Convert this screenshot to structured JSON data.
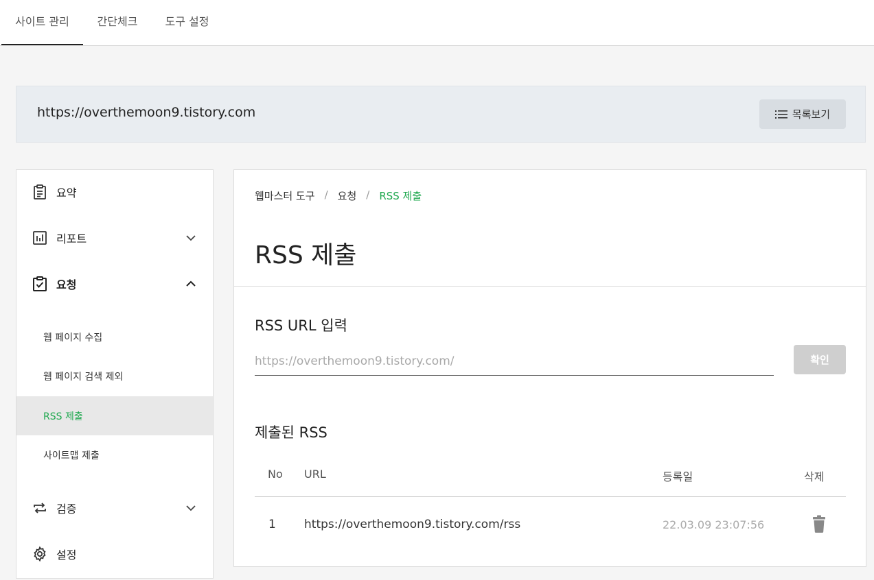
{
  "top_tabs": [
    {
      "label": "사이트 관리",
      "active": true
    },
    {
      "label": "간단체크",
      "active": false
    },
    {
      "label": "도구 설정",
      "active": false
    }
  ],
  "site": {
    "url": "https://overthemoon9.tistory.com",
    "list_button_label": "목록보기"
  },
  "sidebar": {
    "items": [
      {
        "label": "요약",
        "icon": "clipboard-icon"
      },
      {
        "label": "리포트",
        "icon": "chart-icon",
        "expanded": false
      },
      {
        "label": "요청",
        "icon": "checkbox-icon",
        "expanded": true
      },
      {
        "label": "검증",
        "icon": "repeat-icon",
        "expanded": false
      },
      {
        "label": "설정",
        "icon": "gear-icon"
      }
    ],
    "sub_items": [
      {
        "label": "웹 페이지 수집"
      },
      {
        "label": "웹 페이지 검색 제외"
      },
      {
        "label": "RSS 제출",
        "active": true
      },
      {
        "label": "사이트맵 제출"
      }
    ]
  },
  "main": {
    "breadcrumb": [
      "웹마스터 도구",
      "요청",
      "RSS 제출"
    ],
    "breadcrumb_sep": "/",
    "title": "RSS 제출",
    "rss_input": {
      "label": "RSS URL 입력",
      "placeholder": "https://overthemoon9.tistory.com/",
      "button": "확인"
    },
    "submitted": {
      "title": "제출된 RSS",
      "columns": [
        "No",
        "URL",
        "등록일",
        "삭제"
      ],
      "rows": [
        {
          "no": "1",
          "url": "https://overthemoon9.tistory.com/rss",
          "date": "22.03.09 23:07:56"
        }
      ]
    }
  },
  "colors": {
    "accent": "#1fa84f",
    "active_sub_bg": "#e8e8e8",
    "site_bar_bg": "#e9edf1"
  }
}
